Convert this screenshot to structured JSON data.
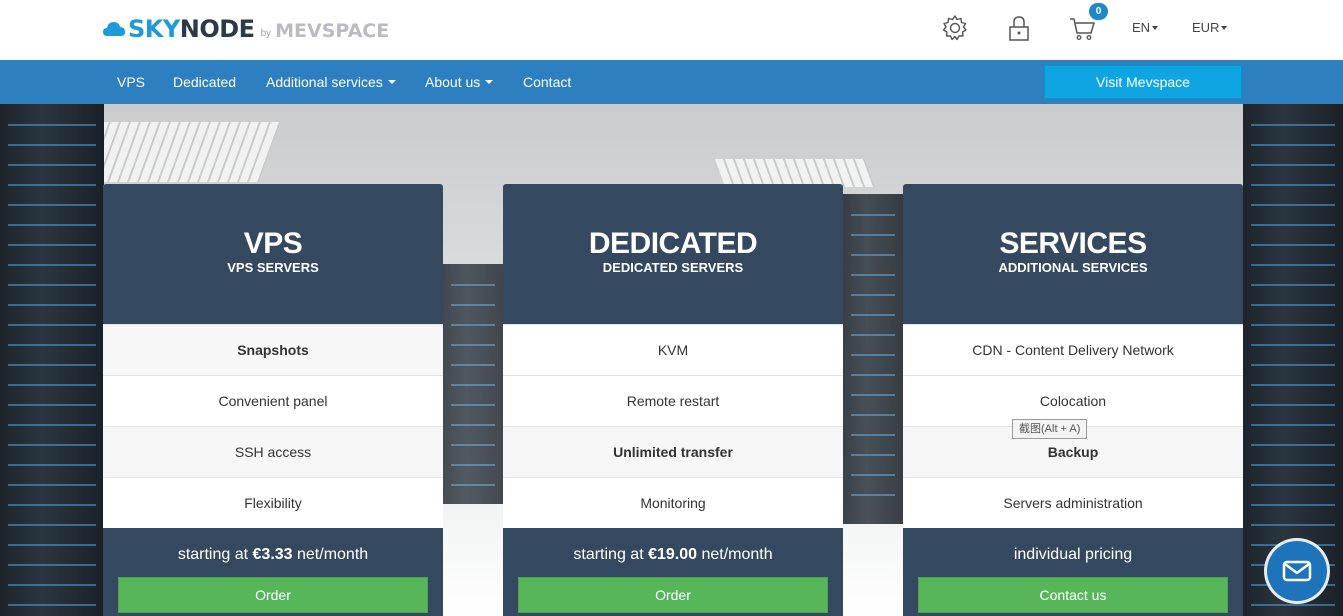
{
  "header": {
    "logo": {
      "part1": "SKY",
      "part2": "NODE",
      "by": "by",
      "partner": "MEVSPACE"
    },
    "cart_count": "0",
    "language": "EN",
    "currency": "EUR",
    "icons": [
      "gear-icon",
      "lock-icon",
      "cart-icon"
    ]
  },
  "nav": {
    "items": [
      "VPS",
      "Dedicated",
      "Additional services",
      "About us",
      "Contact"
    ],
    "visit_button": "Visit Mevspace"
  },
  "cards": [
    {
      "title": "VPS",
      "subtitle": "VPS SERVERS",
      "features": [
        "Snapshots",
        "Convenient panel",
        "SSH access",
        "Flexibility"
      ],
      "price_prefix": "starting at ",
      "price": "€3.33",
      "price_suffix": " net/month",
      "button": "Order"
    },
    {
      "title": "DEDICATED",
      "subtitle": "DEDICATED SERVERS",
      "features": [
        "KVM",
        "Remote restart",
        "Unlimited transfer",
        "Monitoring"
      ],
      "price_prefix": "starting at ",
      "price": "€19.00",
      "price_suffix": " net/month",
      "button": "Order"
    },
    {
      "title": "SERVICES",
      "subtitle": "ADDITIONAL SERVICES",
      "features": [
        "CDN - Content Delivery Network",
        "Colocation",
        "Backup",
        "Servers administration"
      ],
      "price_text": "individual pricing",
      "button": "Contact us"
    }
  ],
  "tooltip": "截图(Alt + A)",
  "colors": {
    "nav": "#2d7fc0",
    "card_head": "#344960",
    "order": "#57b65a",
    "visit": "#0ea5e2"
  }
}
